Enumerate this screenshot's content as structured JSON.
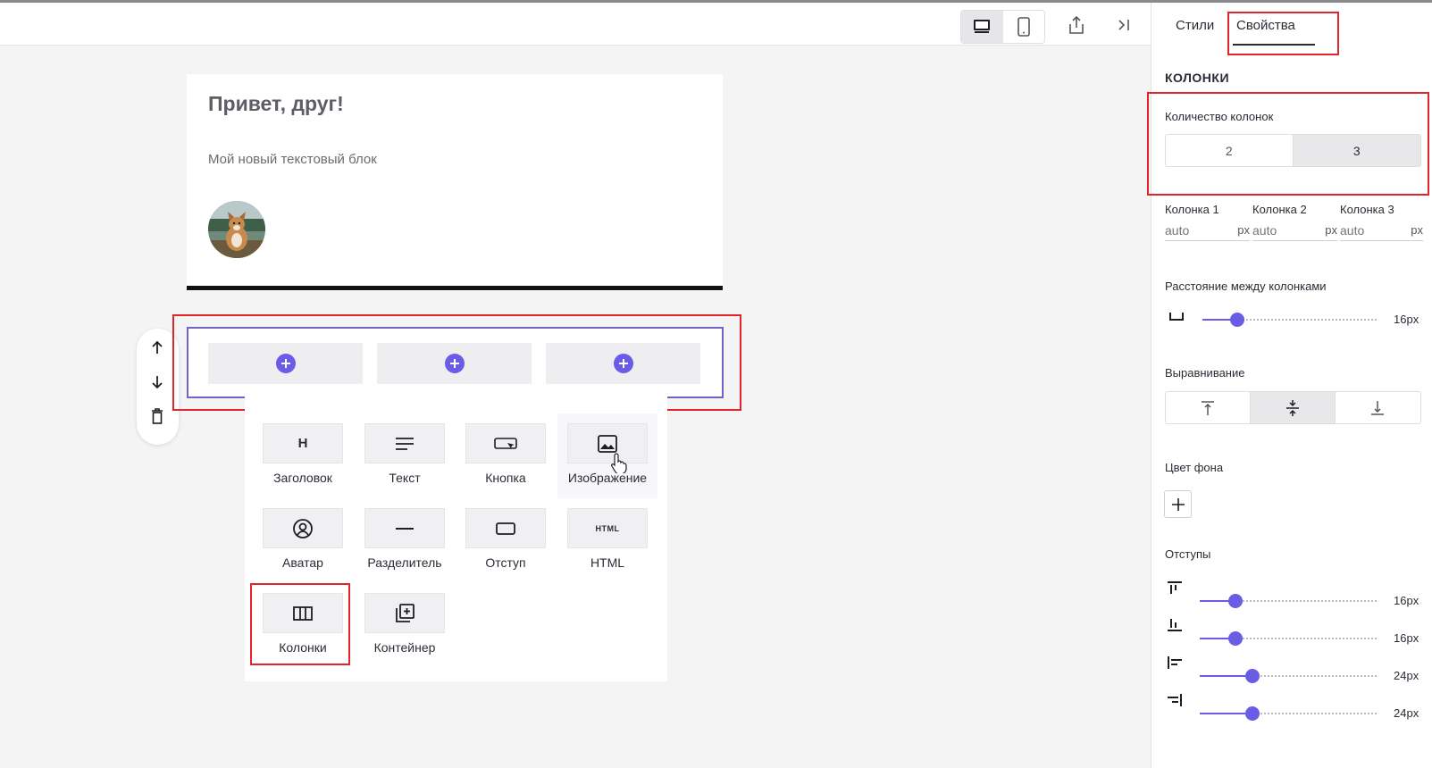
{
  "canvas": {
    "email": {
      "title": "Привет, друг!",
      "text": "Мой новый текстовый блок"
    },
    "row_controls": [
      "arrow-up-icon",
      "arrow-down-icon",
      "trash-icon"
    ],
    "column_slots": 3
  },
  "palette": {
    "items": [
      {
        "label": "Заголовок",
        "icon": "heading-icon",
        "glyph": "H"
      },
      {
        "label": "Текст",
        "icon": "text-icon"
      },
      {
        "label": "Кнопка",
        "icon": "button-icon"
      },
      {
        "label": "Изображение",
        "icon": "image-icon"
      },
      {
        "label": "Аватар",
        "icon": "avatar-icon"
      },
      {
        "label": "Разделитель",
        "icon": "divider-icon"
      },
      {
        "label": "Отступ",
        "icon": "spacer-icon"
      },
      {
        "label": "HTML",
        "icon": "html-icon",
        "glyph": "HTML"
      },
      {
        "label": "Колонки",
        "icon": "columns-icon"
      },
      {
        "label": "Контейнер",
        "icon": "container-icon"
      }
    ]
  },
  "panel": {
    "tabs": [
      "Стили",
      "Свойства"
    ],
    "active_tab": "Свойства",
    "section_title": "КОЛОНКИ",
    "column_count": {
      "label": "Количество колонок",
      "options": [
        "2",
        "3"
      ],
      "selected": "3"
    },
    "columns": [
      {
        "label": "Колонка 1",
        "placeholder": "auto",
        "unit": "px"
      },
      {
        "label": "Колонка 2",
        "placeholder": "auto",
        "unit": "px"
      },
      {
        "label": "Колонка 3",
        "placeholder": "auto",
        "unit": "px"
      }
    ],
    "gap": {
      "label": "Расстояние между колонками",
      "value": "16px",
      "level": 0.2
    },
    "alignment": {
      "label": "Выравнивание",
      "options": [
        "align-top-icon",
        "align-middle-icon",
        "align-bottom-icon"
      ],
      "selected": 1
    },
    "bg_color": {
      "label": "Цвет фона"
    },
    "paddings": {
      "label": "Отступы",
      "items": [
        {
          "icon": "padding-top-icon",
          "value": "16px",
          "level": 0.2
        },
        {
          "icon": "padding-bottom-icon",
          "value": "16px",
          "level": 0.2
        },
        {
          "icon": "padding-left-icon",
          "value": "24px",
          "level": 0.3
        },
        {
          "icon": "padding-right-icon",
          "value": "24px",
          "level": 0.3
        }
      ]
    }
  },
  "colors": {
    "accent": "#6b5ce8",
    "highlight": "#e0242a"
  }
}
